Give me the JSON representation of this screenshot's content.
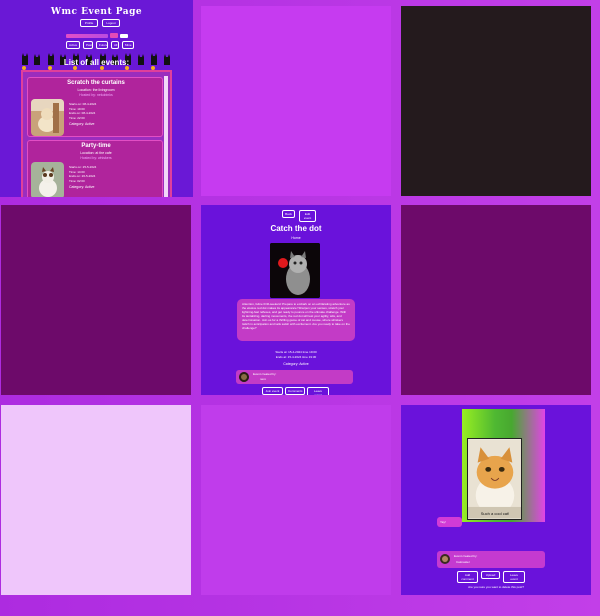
{
  "tiles": {
    "events_list": {
      "page_title": "Wmc Event Page",
      "nav_buttons": [
        "Profile",
        "Logout"
      ],
      "filter_buttons": [
        "Active",
        "Past",
        "Future",
        "All",
        "Mine"
      ],
      "list_title": "List of all events:",
      "events": [
        {
          "title": "Scratch the curtains",
          "location": "Location: the livingroom",
          "host": "Hosted by: nekobinks",
          "start": "Starts on: 08-4-2024",
          "time": "Time: 19:00",
          "ends": "Ends on: 08-4-2024",
          "end_time": "Time: 22:00",
          "category": "Category: Active"
        },
        {
          "title": "Party-time",
          "location": "Location: at the cafe",
          "host": "Hosted by: whiskers",
          "start": "Starts on: 25-5-2024",
          "time": "Time: 14:00",
          "ends": "Ends on: 26-5-2024",
          "end_time": "Time: 02:00",
          "category": "Category: Active"
        }
      ]
    },
    "event_detail": {
      "top_buttons": [
        "Back",
        "Edit event"
      ],
      "title": "Catch the dot",
      "subtitle": "Home",
      "description": "Attention, feline thrill-seekers! Prepare to embark on an exhilarating adventure as the elusive red dot makes its appearance! Sharpen your senses, stretch your lightning-fast reflexes, and get ready to pounce on the ultimate challenge. With its tantalizing, darting movements, the red dot will test your agility, wits, and determination. Join us for a thrilling game of cat and mouse, where whiskers twitch in anticipation and tails swish with excitement. Are you ready to take on the challenge?",
      "starts": "Starts at: 15-4-2024 time 19:00",
      "ends": "Ends at: 15-4-2024 time 19:30",
      "category": "Category: Active",
      "host_label": "Event created by:",
      "host_name": "nero",
      "bottom_buttons": [
        "Join event",
        "Comments",
        "Leave event"
      ]
    },
    "photo_view": {
      "caption": "Such a cool cat!",
      "comment": "Yay!",
      "host_label": "Event created by:",
      "host_name": "Catmaster",
      "bottom_buttons": [
        "Add comment",
        "Upload",
        "Leave event"
      ],
      "footer": "Are you sure you want to delete this post?"
    }
  },
  "colors": {
    "background": "#c03ceb",
    "purple": "#6a18d6",
    "magenta": "#c63bf0",
    "plum": "#6d0a6a",
    "dark": "#241a1d",
    "lavender": "#efc6fb",
    "pink_accent": "#e24ec4"
  }
}
